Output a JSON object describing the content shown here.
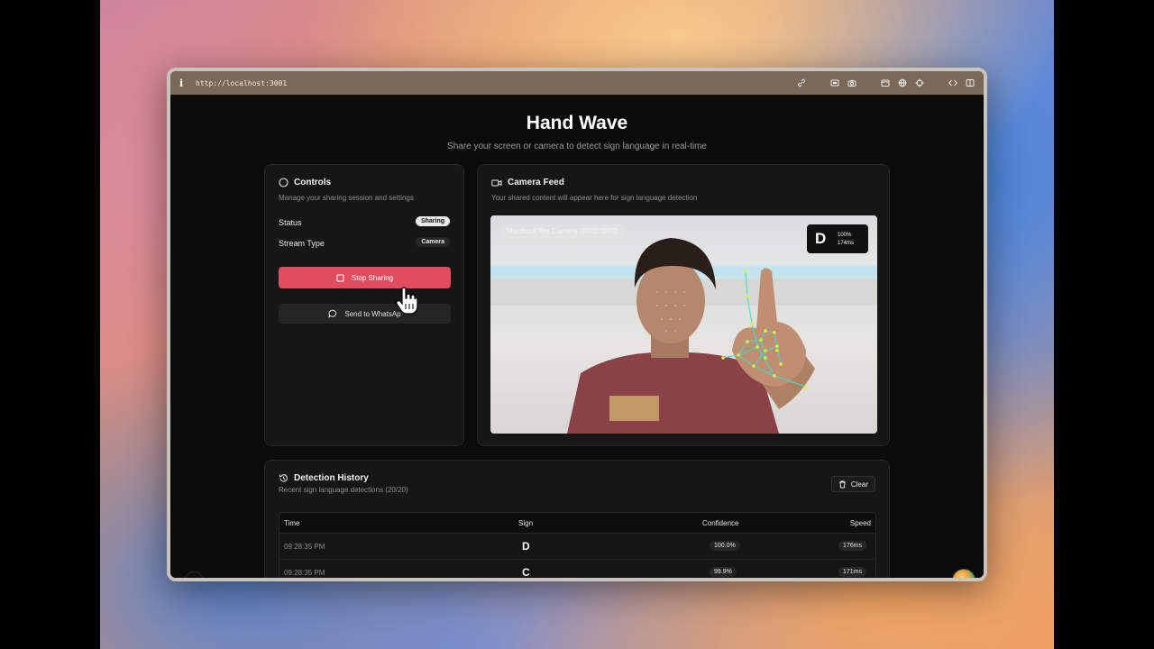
{
  "browser": {
    "url": "http://localhost:3001"
  },
  "page": {
    "title": "Hand Wave",
    "subtitle": "Share your screen or camera to detect sign language in real-time"
  },
  "controls": {
    "title": "Controls",
    "description": "Manage your sharing session and settings",
    "status_label": "Status",
    "status_value": "Sharing",
    "stream_type_label": "Stream Type",
    "stream_type_value": "Camera",
    "stop_button": "Stop Sharing",
    "whatsapp_button": "Send to WhatsAp"
  },
  "feed": {
    "title": "Camera Feed",
    "description": "Your shared content will appear here for sign language detection",
    "camera_label": "MacBook Pro Camera (0000:0000)",
    "prediction": {
      "letter": "D",
      "confidence": "100%",
      "latency": "174ms"
    }
  },
  "history": {
    "title": "Detection History",
    "description": "Recent sign language detections (20/20)",
    "clear_button": "Clear",
    "columns": [
      "Time",
      "Sign",
      "Confidence",
      "Speed"
    ],
    "rows": [
      {
        "time": "09:28:35 PM",
        "sign": "D",
        "confidence": "100.0%",
        "speed": "176ms"
      },
      {
        "time": "09:28:35 PM",
        "sign": "C",
        "confidence": "99.9%",
        "speed": "171ms"
      }
    ]
  },
  "dev_badge": "N",
  "colors": {
    "accent_red": "#e04d5e",
    "background": "#0b0b0b",
    "card": "#161616",
    "toolbar": "#7a6858",
    "landmark_line": "#38e0c8",
    "landmark_point": "#e6f03a"
  }
}
